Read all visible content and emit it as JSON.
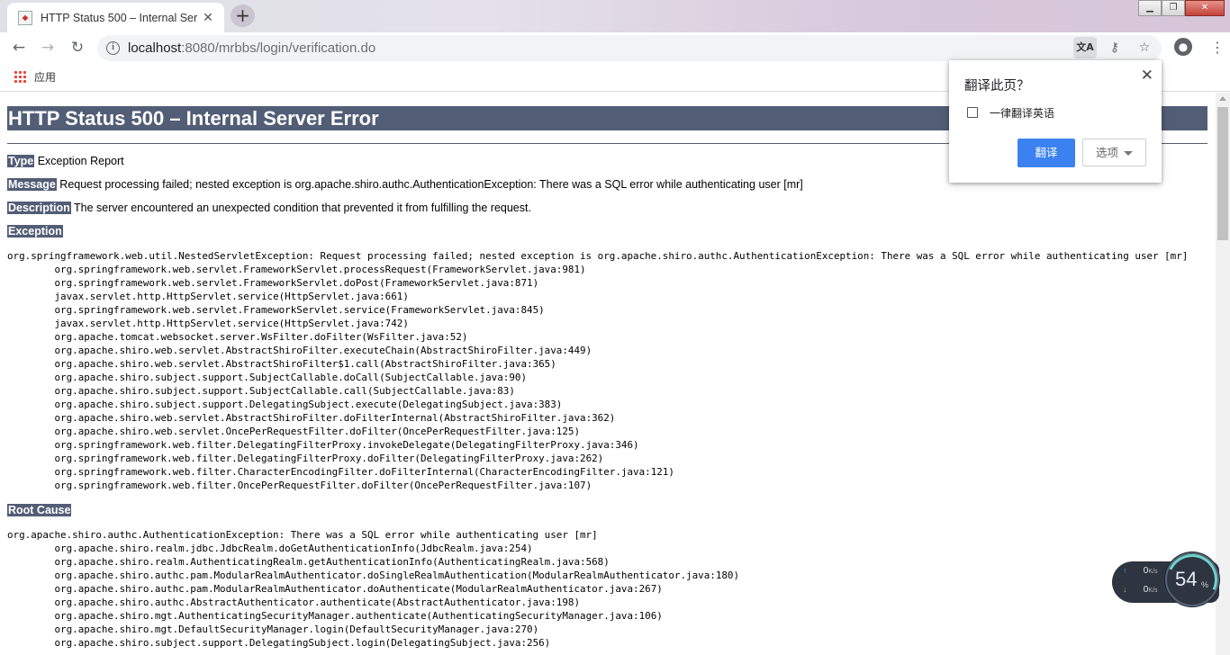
{
  "browser": {
    "tab_title": "HTTP Status 500 – Internal Ser",
    "tab_close": "✕",
    "new_tab": "+",
    "window_controls": {
      "minimize": "▁",
      "maximize": "❐",
      "close": "✕"
    },
    "nav": {
      "back": "←",
      "forward": "→",
      "reload": "↻"
    },
    "url_host": "localhost",
    "url_rest": ":8080/mrbbs/login/verification.do",
    "bookmarks": {
      "apps_label": "应用"
    }
  },
  "page": {
    "title": "HTTP Status 500 – Internal Server Error",
    "type_label": "Type",
    "type_value": " Exception Report",
    "message_label": "Message",
    "message_value": " Request processing failed; nested exception is org.apache.shiro.authc.AuthenticationException: There was a SQL error while authenticating user [mr]",
    "description_label": "Description",
    "description_value": " The server encountered an unexpected condition that prevented it from fulfilling the request.",
    "exception_label": "Exception",
    "exception_trace": "org.springframework.web.util.NestedServletException: Request processing failed; nested exception is org.apache.shiro.authc.AuthenticationException: There was a SQL error while authenticating user [mr]\n\torg.springframework.web.servlet.FrameworkServlet.processRequest(FrameworkServlet.java:981)\n\torg.springframework.web.servlet.FrameworkServlet.doPost(FrameworkServlet.java:871)\n\tjavax.servlet.http.HttpServlet.service(HttpServlet.java:661)\n\torg.springframework.web.servlet.FrameworkServlet.service(FrameworkServlet.java:845)\n\tjavax.servlet.http.HttpServlet.service(HttpServlet.java:742)\n\torg.apache.tomcat.websocket.server.WsFilter.doFilter(WsFilter.java:52)\n\torg.apache.shiro.web.servlet.AbstractShiroFilter.executeChain(AbstractShiroFilter.java:449)\n\torg.apache.shiro.web.servlet.AbstractShiroFilter$1.call(AbstractShiroFilter.java:365)\n\torg.apache.shiro.subject.support.SubjectCallable.doCall(SubjectCallable.java:90)\n\torg.apache.shiro.subject.support.SubjectCallable.call(SubjectCallable.java:83)\n\torg.apache.shiro.subject.support.DelegatingSubject.execute(DelegatingSubject.java:383)\n\torg.apache.shiro.web.servlet.AbstractShiroFilter.doFilterInternal(AbstractShiroFilter.java:362)\n\torg.apache.shiro.web.servlet.OncePerRequestFilter.doFilter(OncePerRequestFilter.java:125)\n\torg.springframework.web.filter.DelegatingFilterProxy.invokeDelegate(DelegatingFilterProxy.java:346)\n\torg.springframework.web.filter.DelegatingFilterProxy.doFilter(DelegatingFilterProxy.java:262)\n\torg.springframework.web.filter.CharacterEncodingFilter.doFilterInternal(CharacterEncodingFilter.java:121)\n\torg.springframework.web.filter.OncePerRequestFilter.doFilter(OncePerRequestFilter.java:107)",
    "root_cause_label": "Root Cause",
    "root_cause_trace": "org.apache.shiro.authc.AuthenticationException: There was a SQL error while authenticating user [mr]\n\torg.apache.shiro.realm.jdbc.JdbcRealm.doGetAuthenticationInfo(JdbcRealm.java:254)\n\torg.apache.shiro.realm.AuthenticatingRealm.getAuthenticationInfo(AuthenticatingRealm.java:568)\n\torg.apache.shiro.authc.pam.ModularRealmAuthenticator.doSingleRealmAuthentication(ModularRealmAuthenticator.java:180)\n\torg.apache.shiro.authc.pam.ModularRealmAuthenticator.doAuthenticate(ModularRealmAuthenticator.java:267)\n\torg.apache.shiro.authc.AbstractAuthenticator.authenticate(AbstractAuthenticator.java:198)\n\torg.apache.shiro.mgt.AuthenticatingSecurityManager.authenticate(AuthenticatingSecurityManager.java:106)\n\torg.apache.shiro.mgt.DefaultSecurityManager.login(DefaultSecurityManager.java:270)\n\torg.apache.shiro.subject.support.DelegatingSubject.login(DelegatingSubject.java:256)"
  },
  "translate_popup": {
    "title": "翻译此页？",
    "close": "✕",
    "always_translate_label": "一律翻译英语",
    "translate_button": "翻译",
    "options_button": "选项"
  },
  "net_widget": {
    "upload": "0",
    "download": "0",
    "unit": "K/s",
    "up_arrow": "↑",
    "down_arrow": "↓",
    "percent": "54",
    "percent_sign": "%"
  },
  "colors": {
    "header_bg": "#525d76",
    "translate_blue": "#3b82f0"
  }
}
